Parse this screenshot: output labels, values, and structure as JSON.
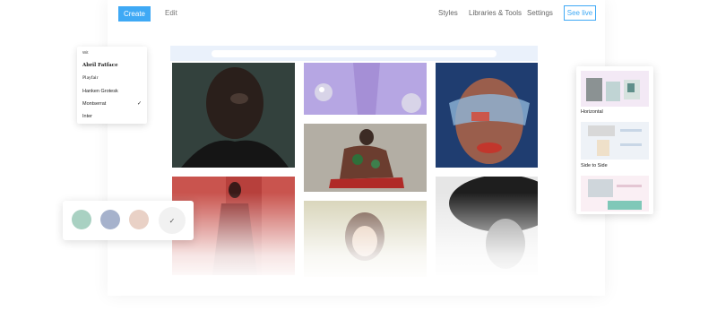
{
  "toolbar": {
    "create_label": "Create",
    "edit_label": "Edit",
    "styles_label": "Styles",
    "libraries_label": "Libraries & Tools",
    "settings_label": "Settings",
    "see_live_label": "See live"
  },
  "font_menu": {
    "items": [
      "Wit",
      "Abril Fatface",
      "Playfair",
      "Hanken Grotesk",
      "Montserrat",
      "Inter"
    ],
    "selected": "Montserrat",
    "check_glyph": "✓"
  },
  "color_swatches": {
    "colors": [
      "#a9d1c2",
      "#a6b2cc",
      "#e9d1c6"
    ],
    "selected_check": "✓"
  },
  "layouts_panel": {
    "labels": [
      "Horizontal",
      "Side to Side"
    ]
  },
  "colors": {
    "accent": "#3fa9f5"
  }
}
